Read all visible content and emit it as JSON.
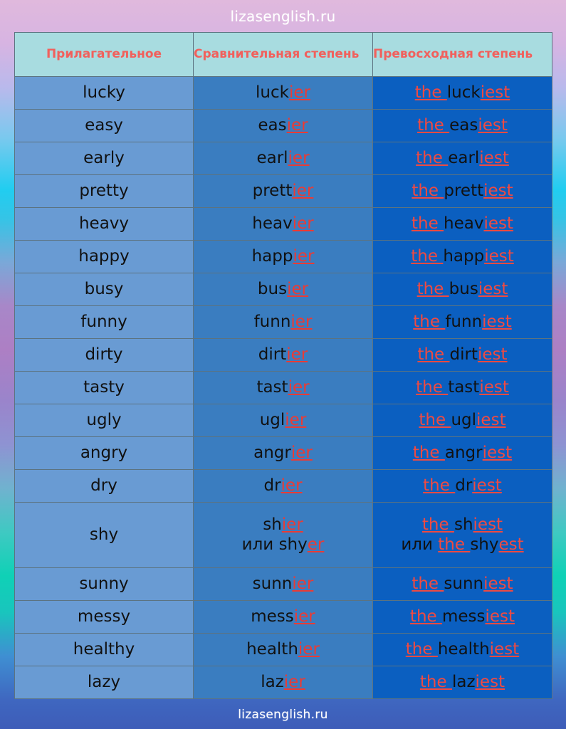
{
  "brand": {
    "top": "lizasenglish.ru",
    "bottom": "lizasenglish.ru"
  },
  "colors": {
    "accent_red": "#ea3b35",
    "header_text": "#f1605c",
    "header_bg": "#a8dce0",
    "col1_bg": "#699bd3",
    "col2_bg": "#3a7dc0",
    "col3_bg": "#0b5fc0",
    "text_black": "#111111"
  },
  "table": {
    "headers": [
      "Прилагательное",
      "Сравнительная степень",
      "Превосходная степень"
    ],
    "rows": [
      {
        "adjective": "lucky",
        "comparative": {
          "stem": "luck",
          "suffix": "ier"
        },
        "superlative": {
          "article": "the ",
          "stem": "luck",
          "suffix": "iest"
        }
      },
      {
        "adjective": "easy",
        "comparative": {
          "stem": "eas",
          "suffix": "ier"
        },
        "superlative": {
          "article": "the ",
          "stem": "eas",
          "suffix": "iest"
        }
      },
      {
        "adjective": "early",
        "comparative": {
          "stem": "earl",
          "suffix": "ier"
        },
        "superlative": {
          "article": "the ",
          "stem": "earl",
          "suffix": "iest"
        }
      },
      {
        "adjective": "pretty",
        "comparative": {
          "stem": "prett",
          "suffix": "ier"
        },
        "superlative": {
          "article": "the ",
          "stem": "prett",
          "suffix": "iest"
        }
      },
      {
        "adjective": "heavy",
        "comparative": {
          "stem": "heav",
          "suffix": "ier"
        },
        "superlative": {
          "article": "the ",
          "stem": "heav",
          "suffix": "iest"
        }
      },
      {
        "adjective": "happy",
        "comparative": {
          "stem": "happ",
          "suffix": "ier"
        },
        "superlative": {
          "article": "the ",
          "stem": "happ",
          "suffix": "iest"
        }
      },
      {
        "adjective": "busy",
        "comparative": {
          "stem": "bus",
          "suffix": "ier"
        },
        "superlative": {
          "article": "the ",
          "stem": "bus",
          "suffix": "iest"
        }
      },
      {
        "adjective": "funny",
        "comparative": {
          "stem": "funn",
          "suffix": "ier"
        },
        "superlative": {
          "article": "the ",
          "stem": "funn",
          "suffix": "iest"
        }
      },
      {
        "adjective": "dirty",
        "comparative": {
          "stem": "dirt",
          "suffix": "ier"
        },
        "superlative": {
          "article": "the ",
          "stem": "dirt",
          "suffix": "iest"
        }
      },
      {
        "adjective": "tasty",
        "comparative": {
          "stem": "tast",
          "suffix": "ier"
        },
        "superlative": {
          "article": "the ",
          "stem": "tast",
          "suffix": "iest"
        }
      },
      {
        "adjective": "ugly",
        "comparative": {
          "stem": "ugl",
          "suffix": "ier"
        },
        "superlative": {
          "article": "the ",
          "stem": "ugl",
          "suffix": "iest"
        }
      },
      {
        "adjective": "angry",
        "comparative": {
          "stem": "angr",
          "suffix": "ier"
        },
        "superlative": {
          "article": "the ",
          "stem": "angr",
          "suffix": "iest"
        }
      },
      {
        "adjective": "dry",
        "comparative": {
          "stem": "dr",
          "suffix": "ier"
        },
        "superlative": {
          "article": "the ",
          "stem": "dr",
          "suffix": "iest"
        }
      },
      {
        "adjective": "shy",
        "two_line": true,
        "comparative": {
          "stem": "sh",
          "suffix": "ier"
        },
        "comparative_alt": {
          "conj": "или ",
          "stem": "shy",
          "suffix": "er "
        },
        "superlative": {
          "article": "the ",
          "stem": "sh",
          "suffix": "iest"
        },
        "superlative_alt": {
          "conj": "или ",
          "article": "the ",
          "stem": "shy",
          "suffix": "est"
        }
      },
      {
        "adjective": "sunny",
        "comparative": {
          "stem": "sunn",
          "suffix": "ier"
        },
        "superlative": {
          "article": "the ",
          "stem": "sunn",
          "suffix": "iest"
        }
      },
      {
        "adjective": "messy",
        "comparative": {
          "stem": "mess",
          "suffix": "ier"
        },
        "superlative": {
          "article": "the ",
          "stem": "mess",
          "suffix": "iest"
        }
      },
      {
        "adjective": "healthy",
        "comparative": {
          "stem": "health",
          "suffix": "ier"
        },
        "superlative": {
          "article": "the ",
          "stem": "health",
          "suffix": "iest"
        }
      },
      {
        "adjective": "lazy",
        "comparative": {
          "stem": "laz",
          "suffix": "ier"
        },
        "superlative": {
          "article": "the ",
          "stem": "laz",
          "suffix": "iest"
        }
      }
    ]
  }
}
